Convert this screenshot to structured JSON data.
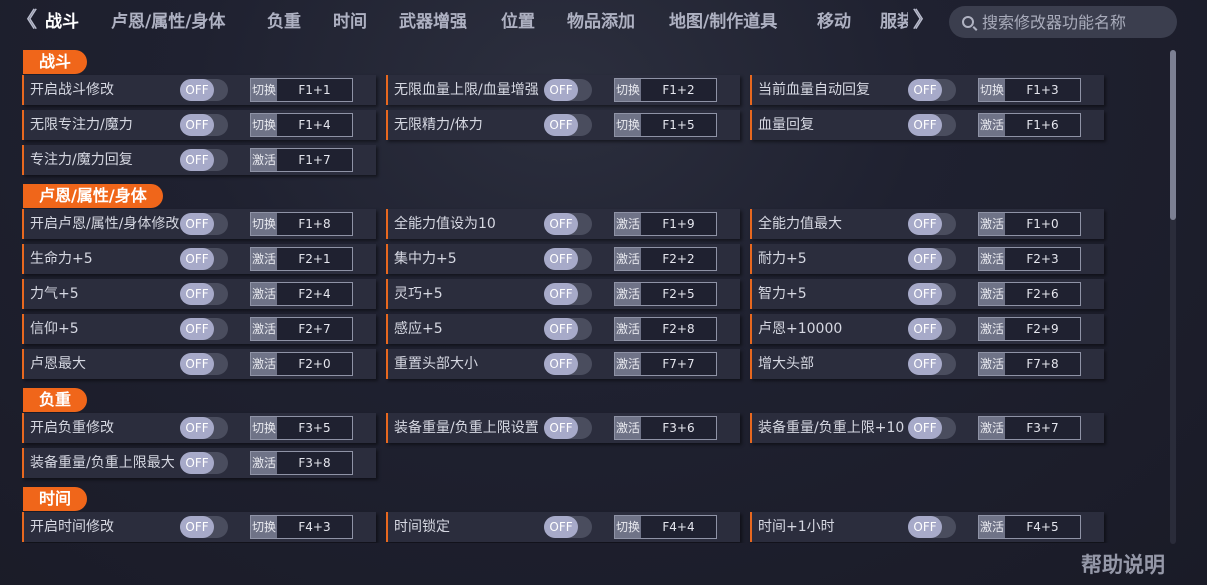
{
  "nav": {
    "tabs": [
      "战斗",
      "卢恩/属性/身体",
      "负重",
      "时间",
      "武器增强",
      "位置",
      "物品添加",
      "地图/制作道具",
      "移动"
    ],
    "clipped_tab": "服装",
    "left_arrow": "〈〈",
    "right_arrow": "〉〉"
  },
  "search": {
    "placeholder": "搜索修改器功能名称"
  },
  "help_label": "帮助说明",
  "off_label": "OFF",
  "sections": [
    {
      "title": "战斗",
      "rows": [
        [
          {
            "label": "开启战斗修改",
            "mode": "切换",
            "key": "F1+1"
          },
          {
            "label": "无限血量上限/血量增强",
            "mode": "切换",
            "key": "F1+2"
          },
          {
            "label": "当前血量自动回复",
            "mode": "切换",
            "key": "F1+3"
          }
        ],
        [
          {
            "label": "无限专注力/魔力",
            "mode": "切换",
            "key": "F1+4"
          },
          {
            "label": "无限精力/体力",
            "mode": "切换",
            "key": "F1+5"
          },
          {
            "label": "血量回复",
            "mode": "激活",
            "key": "F1+6"
          }
        ],
        [
          {
            "label": "专注力/魔力回复",
            "mode": "激活",
            "key": "F1+7"
          }
        ]
      ]
    },
    {
      "title": "卢恩/属性/身体",
      "rows": [
        [
          {
            "label": "开启卢恩/属性/身体修改",
            "mode": "切换",
            "key": "F1+8"
          },
          {
            "label": "全能力值设为10",
            "mode": "激活",
            "key": "F1+9"
          },
          {
            "label": "全能力值最大",
            "mode": "激活",
            "key": "F1+0"
          }
        ],
        [
          {
            "label": "生命力+5",
            "mode": "激活",
            "key": "F2+1"
          },
          {
            "label": "集中力+5",
            "mode": "激活",
            "key": "F2+2"
          },
          {
            "label": "耐力+5",
            "mode": "激活",
            "key": "F2+3"
          }
        ],
        [
          {
            "label": "力气+5",
            "mode": "激活",
            "key": "F2+4"
          },
          {
            "label": "灵巧+5",
            "mode": "激活",
            "key": "F2+5"
          },
          {
            "label": "智力+5",
            "mode": "激活",
            "key": "F2+6"
          }
        ],
        [
          {
            "label": "信仰+5",
            "mode": "激活",
            "key": "F2+7"
          },
          {
            "label": "感应+5",
            "mode": "激活",
            "key": "F2+8"
          },
          {
            "label": "卢恩+10000",
            "mode": "激活",
            "key": "F2+9"
          }
        ],
        [
          {
            "label": "卢恩最大",
            "mode": "激活",
            "key": "F2+0"
          },
          {
            "label": "重置头部大小",
            "mode": "激活",
            "key": "F7+7"
          },
          {
            "label": "增大头部",
            "mode": "激活",
            "key": "F7+8"
          }
        ]
      ]
    },
    {
      "title": "负重",
      "rows": [
        [
          {
            "label": "开启负重修改",
            "mode": "切换",
            "key": "F3+5"
          },
          {
            "label": "装备重量/负重上限设置",
            "mode": "激活",
            "key": "F3+6"
          },
          {
            "label": "装备重量/负重上限+10",
            "mode": "激活",
            "key": "F3+7"
          }
        ],
        [
          {
            "label": "装备重量/负重上限最大",
            "mode": "激活",
            "key": "F3+8"
          }
        ]
      ]
    },
    {
      "title": "时间",
      "rows": [
        [
          {
            "label": "开启时间修改",
            "mode": "切换",
            "key": "F4+3"
          },
          {
            "label": "时间锁定",
            "mode": "切换",
            "key": "F4+4"
          },
          {
            "label": "时间+1小时",
            "mode": "激活",
            "key": "F4+5"
          }
        ]
      ]
    }
  ]
}
